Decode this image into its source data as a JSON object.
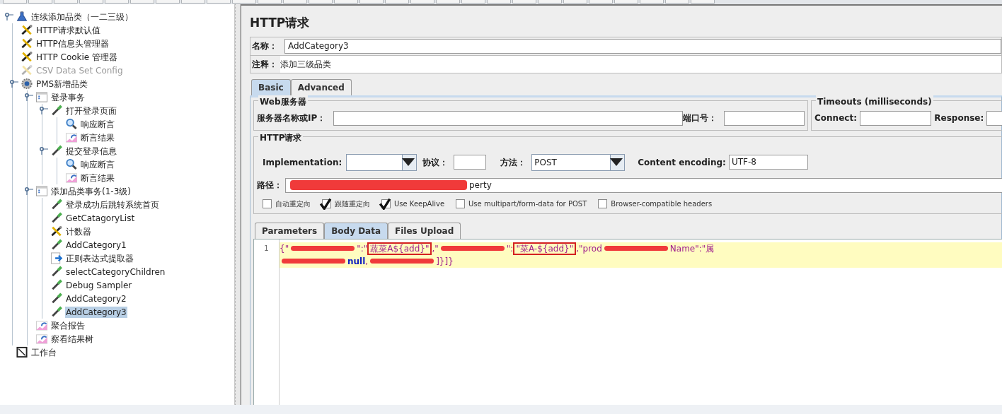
{
  "tree": [
    {
      "label": "连续添加品类（一二三级）",
      "kind": "testplan",
      "expanded": true,
      "children": [
        {
          "label": "HTTP请求默认值",
          "kind": "config"
        },
        {
          "label": "HTTP信息头管理器",
          "kind": "config"
        },
        {
          "label": "HTTP Cookie 管理器",
          "kind": "config"
        },
        {
          "label": "CSV Data Set Config",
          "kind": "config",
          "disabled": true
        },
        {
          "label": "PMS新增品类",
          "kind": "threadgroup",
          "expanded": true,
          "children": [
            {
              "label": "登录事务",
              "kind": "transaction",
              "expanded": true,
              "children": [
                {
                  "label": "打开登录页面",
                  "kind": "sampler",
                  "expanded": true,
                  "children": [
                    {
                      "label": "响应断言",
                      "kind": "assertion"
                    },
                    {
                      "label": "断言结果",
                      "kind": "listener"
                    }
                  ]
                },
                {
                  "label": "提交登录信息",
                  "kind": "sampler",
                  "expanded": true,
                  "children": [
                    {
                      "label": "响应断言",
                      "kind": "assertion"
                    },
                    {
                      "label": "断言结果",
                      "kind": "listener"
                    }
                  ]
                }
              ]
            },
            {
              "label": "添加品类事务(1-3级)",
              "kind": "transaction",
              "expanded": true,
              "children": [
                {
                  "label": "登录成功后跳转系统首页",
                  "kind": "sampler"
                },
                {
                  "label": "GetCatagoryList",
                  "kind": "sampler"
                },
                {
                  "label": "计数器",
                  "kind": "config"
                },
                {
                  "label": "AddCategory1",
                  "kind": "sampler"
                },
                {
                  "label": "正则表达式提取器",
                  "kind": "extractor"
                },
                {
                  "label": "selectCategoryChildren",
                  "kind": "sampler"
                },
                {
                  "label": "Debug Sampler",
                  "kind": "sampler"
                },
                {
                  "label": "AddCategory2",
                  "kind": "sampler"
                },
                {
                  "label": "AddCategory3",
                  "kind": "sampler",
                  "selected": true
                }
              ]
            },
            {
              "label": "聚合报告",
              "kind": "listener"
            },
            {
              "label": "察看结果树",
              "kind": "listener"
            }
          ]
        }
      ]
    },
    {
      "label": "工作台",
      "kind": "workbench"
    }
  ],
  "editor": {
    "title": "HTTP请求",
    "name_label": "名称：",
    "name_value": "AddCategory3",
    "comment_label": "注释：",
    "comment_value": "添加三级品类",
    "tabs": [
      {
        "label": "Basic",
        "selected": true
      },
      {
        "label": "Advanced",
        "selected": false
      }
    ],
    "web_server": {
      "legend": "Web服务器",
      "server_label": "服务器名称或IP：",
      "port_label": "端口号："
    },
    "timeouts": {
      "legend": "Timeouts (milliseconds)",
      "connect_label": "Connect:",
      "response_label": "Response:"
    },
    "http_request": {
      "legend": "HTTP请求",
      "implementation_label": "Implementation:",
      "protocol_label": "协议：",
      "method_label": "方法：",
      "method_value": "POST",
      "encoding_label": "Content encoding:",
      "encoding_value": "UTF-8",
      "path_label": "路径：",
      "path_value": "perty"
    },
    "options": [
      {
        "label": "自动重定向",
        "checked": false
      },
      {
        "label": "跟随重定向",
        "checked": true
      },
      {
        "label": "Use KeepAlive",
        "checked": true
      },
      {
        "label": "Use multipart/form-data for POST",
        "checked": false
      },
      {
        "label": "Browser-compatible headers",
        "checked": false
      }
    ],
    "body_tabs": [
      {
        "label": "Parameters",
        "selected": false
      },
      {
        "label": "Body Data",
        "selected": true
      },
      {
        "label": "Files Upload",
        "selected": false
      }
    ],
    "body_rows": [
      {
        "line_number": "1",
        "segments": [
          {
            "kind": "plain",
            "text": "{\""
          },
          {
            "kind": "redacted"
          },
          {
            "kind": "plain",
            "text": "\":\""
          },
          {
            "kind": "boxed",
            "text": "蔬菜A${add}\""
          },
          {
            "kind": "plain",
            "text": ",\""
          },
          {
            "kind": "redacted"
          },
          {
            "kind": "plain",
            "text": "\":"
          },
          {
            "kind": "boxed",
            "text": "\"菜A-${add}\""
          },
          {
            "kind": "plain",
            "text": ",\"prod"
          },
          {
            "kind": "redacted"
          },
          {
            "kind": "plain",
            "text": "Name\":\"属"
          }
        ]
      },
      {
        "segments": [
          {
            "kind": "redacted"
          },
          {
            "kind": "keyword",
            "text": "null"
          },
          {
            "kind": "plain",
            "text": ","
          },
          {
            "kind": "redacted"
          },
          {
            "kind": "plain",
            "text": "]}]}"
          }
        ]
      }
    ]
  }
}
